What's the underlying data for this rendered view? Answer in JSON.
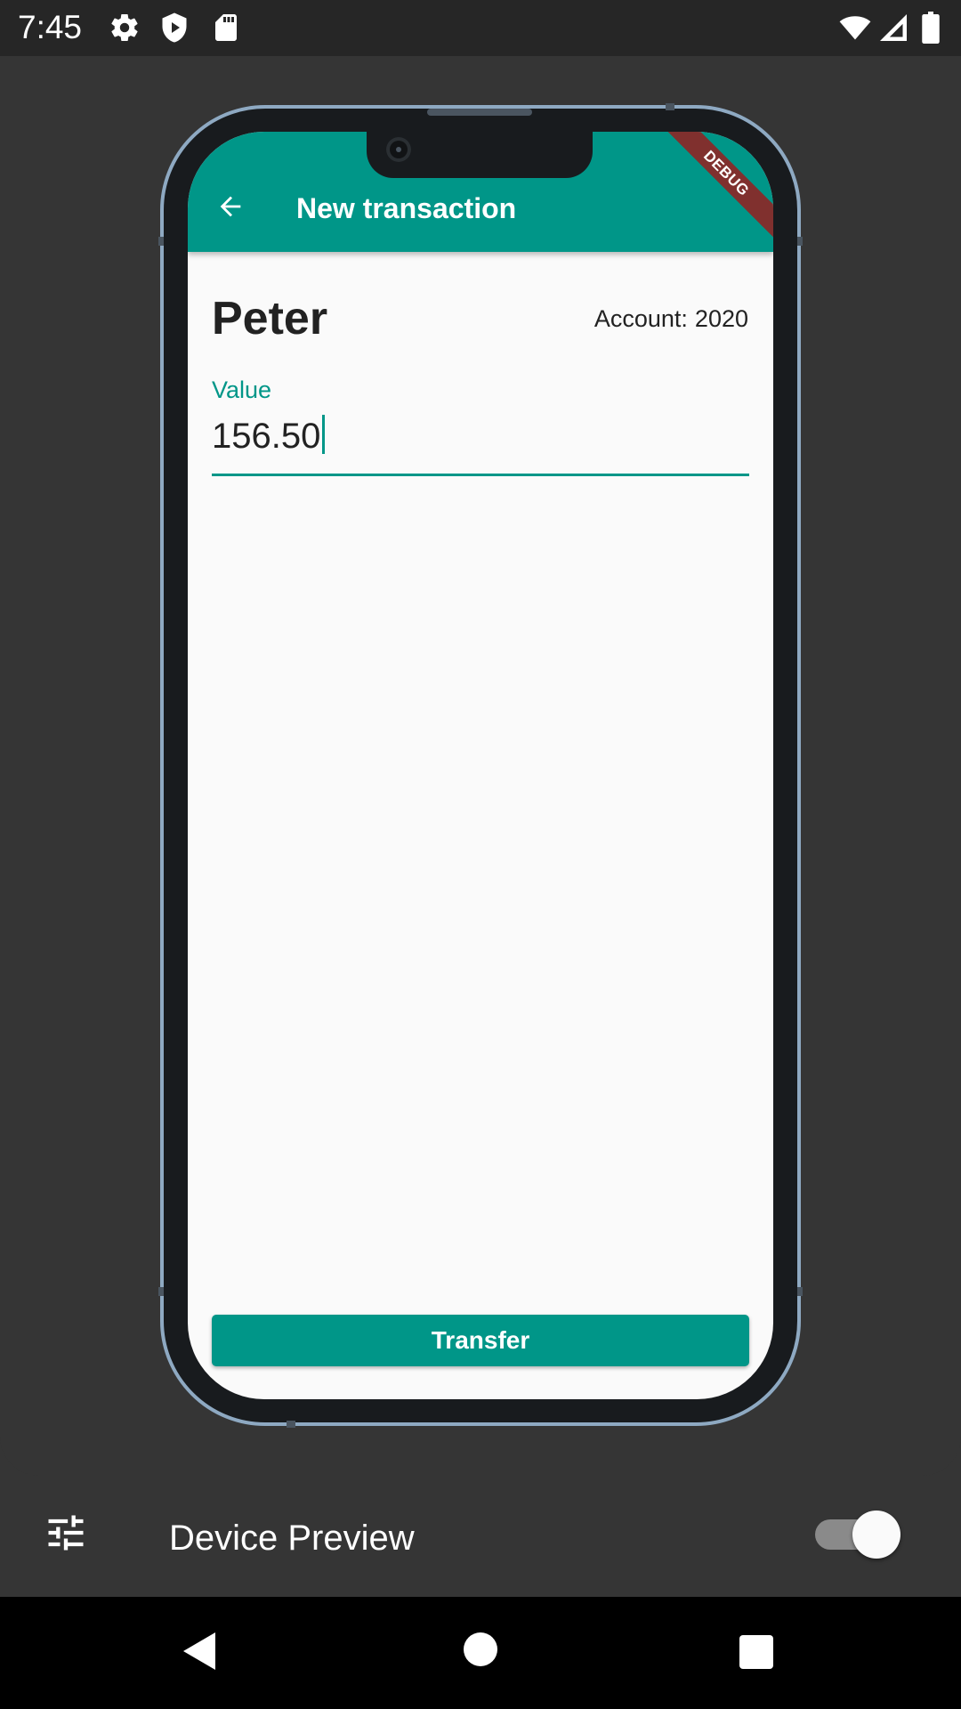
{
  "status_bar": {
    "time": "7:45",
    "left_icons": [
      "gear-icon",
      "shield-play-icon",
      "sd-card-icon"
    ],
    "right_icons": [
      "wifi-icon",
      "cell-signal-icon",
      "battery-icon"
    ]
  },
  "app": {
    "title": "New transaction",
    "debug_banner": "DEBUG",
    "contact_name": "Peter",
    "account_label": "Account:",
    "account_number": "2020",
    "value_label": "Value",
    "value": "156.50",
    "transfer_label": "Transfer"
  },
  "device_preview": {
    "label": "Device Preview",
    "enabled": true
  },
  "nav_bar": {
    "buttons": [
      "back-triangle-icon",
      "home-circle-icon",
      "recents-square-icon"
    ]
  },
  "colors": {
    "primary": "#009688",
    "debug_banner": "#80302e",
    "background": "#353535",
    "screen_background": "#fafafa",
    "frame_border": "#8ea9c2"
  }
}
